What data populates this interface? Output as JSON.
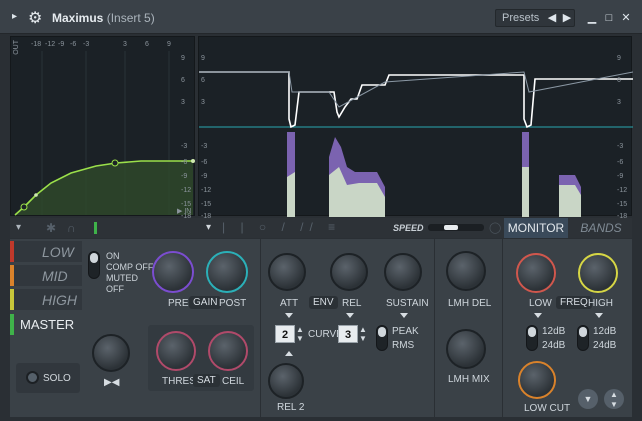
{
  "window": {
    "title": "Maximus",
    "subtitle": "(Insert 5)",
    "presets_label": "Presets"
  },
  "left_graph": {
    "out_label": "OUT",
    "in_label": "IN",
    "x_ticks": [
      "-18",
      "-12",
      "-9",
      "-6",
      "-3",
      "3",
      "6",
      "9"
    ],
    "y_ticks": [
      "9",
      "6",
      "3",
      "-3",
      "-6",
      "-9",
      "-12",
      "-15",
      "-18"
    ]
  },
  "right_graph": {
    "y_ticks_left": [
      "9",
      "6",
      "3",
      "-3",
      "-6",
      "-9",
      "-12",
      "-15",
      "-18"
    ],
    "y_ticks_right": [
      "9",
      "6",
      "3",
      "-3",
      "-6",
      "-9",
      "-12",
      "-15",
      "-18"
    ]
  },
  "toolbar": {
    "speed_label": "SPEED",
    "monitor_label": "MONITOR",
    "bands_label": "BANDS"
  },
  "bands": {
    "low": "LOW",
    "mid": "MID",
    "high": "HIGH",
    "master": "MASTER",
    "colors": {
      "low": "#c0392b",
      "mid": "#d9822b",
      "high": "#c7c63a",
      "master": "#3fb24a"
    }
  },
  "mode_options": [
    "ON",
    "COMP OFF",
    "MUTED",
    "OFF"
  ],
  "solo_label": "SOLO",
  "gain": {
    "pre": "PRE",
    "gain": "GAIN",
    "post": "POST"
  },
  "sat": {
    "thres": "THRES",
    "sat": "SAT",
    "ceil": "CEIL"
  },
  "env": {
    "att": "ATT",
    "env": "ENV",
    "rel": "REL",
    "sustain": "SUSTAIN",
    "curve_left": "2",
    "curve": "CURVE",
    "curve_right": "3",
    "peak": "PEAK",
    "rms": "RMS",
    "rel2": "REL 2"
  },
  "lmh": {
    "del": "LMH DEL",
    "mix": "LMH MIX"
  },
  "xover": {
    "low": "LOW",
    "freq": "FREQ",
    "high": "HIGH",
    "db12a": "12dB",
    "db24a": "24dB",
    "db12b": "12dB",
    "db24b": "24dB",
    "low_cut": "LOW CUT"
  }
}
